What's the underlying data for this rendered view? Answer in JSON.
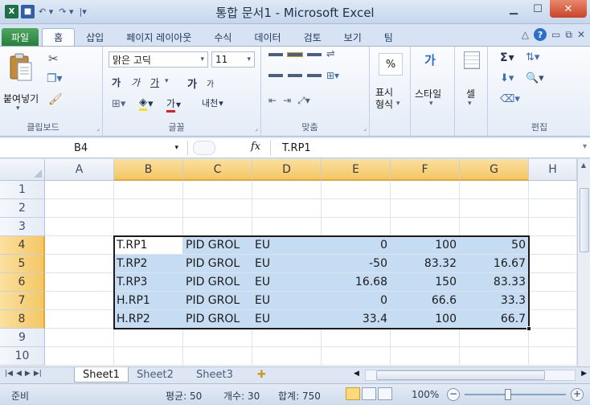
{
  "app": {
    "title": "통합 문서1 - Microsoft Excel"
  },
  "ribbon_tabs": [
    "파일",
    "홈",
    "삽입",
    "페이지 레이아웃",
    "수식",
    "데이터",
    "검토",
    "보기",
    "팀"
  ],
  "ribbon": {
    "clipboard_group": "클립보드",
    "paste_label": "붙여넣기",
    "font_group": "글꼴",
    "font_name": "맑은 고딕",
    "font_size": "11",
    "bold_glyph": "가",
    "italic_glyph": "가",
    "underline_glyph": "가",
    "grow_glyph": "가",
    "shrink_glyph": "가",
    "font_color_glyph": "가",
    "phonetic_glyph": "내천",
    "alignment_group": "맞춤",
    "number_group_label": "표시\n형식",
    "percent": "%",
    "styles_label": "스타일",
    "styles_glyph": "가",
    "cells_label": "셀",
    "editing_group": "편집",
    "sigma": "Σ"
  },
  "formula_bar": {
    "name_box": "B4",
    "fx": "fx",
    "content": "T.RP1"
  },
  "columns": [
    "A",
    "B",
    "C",
    "D",
    "E",
    "F",
    "G",
    "H"
  ],
  "rows": [
    "1",
    "2",
    "3",
    "4",
    "5",
    "6",
    "7",
    "8",
    "9",
    "10"
  ],
  "data_rows": [
    {
      "row": "4",
      "b": "T.RP1",
      "c": "PID GROL",
      "d": "EU",
      "e": "0",
      "f": "100",
      "g": "50"
    },
    {
      "row": "5",
      "b": "T.RP2",
      "c": "PID GROL",
      "d": "EU",
      "e": "-50",
      "f": "83.32",
      "g": "16.67"
    },
    {
      "row": "6",
      "b": "T.RP3",
      "c": "PID GROL",
      "d": "EU",
      "e": "16.68",
      "f": "150",
      "g": "83.33"
    },
    {
      "row": "7",
      "b": "H.RP1",
      "c": "PID GROL",
      "d": "EU",
      "e": "0",
      "f": "66.6",
      "g": "33.3"
    },
    {
      "row": "8",
      "b": "H.RP2",
      "c": "PID GROL",
      "d": "EU",
      "e": "33.4",
      "f": "100",
      "g": "66.7"
    }
  ],
  "sheets": [
    "Sheet1",
    "Sheet2",
    "Sheet3"
  ],
  "status": {
    "ready": "준비",
    "average": "평균: 50",
    "count": "개수: 30",
    "sum": "합계: 750",
    "zoom": "100%"
  }
}
